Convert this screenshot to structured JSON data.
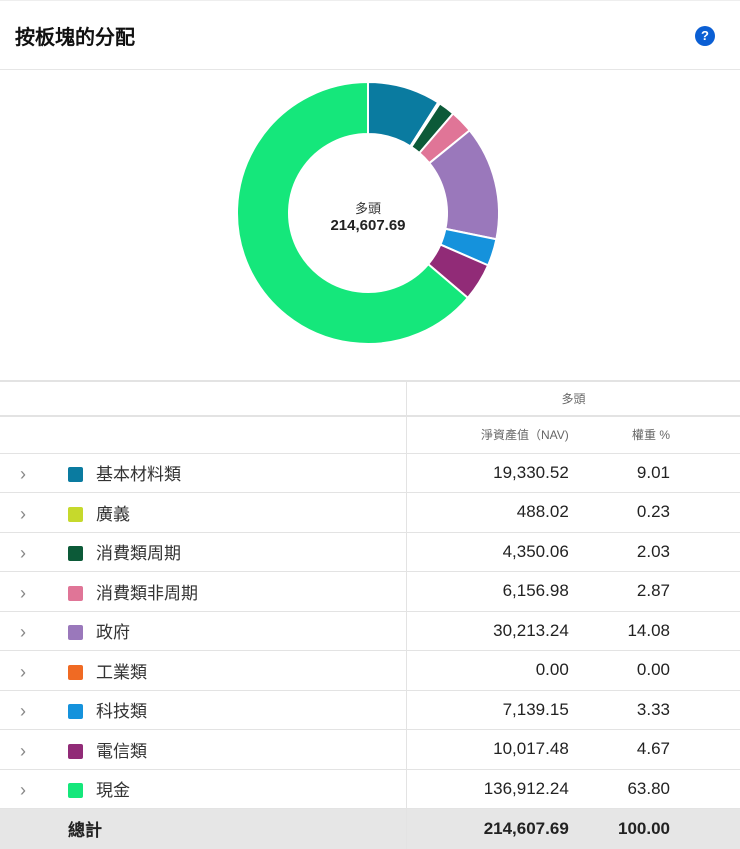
{
  "header": {
    "title": "按板塊的分配",
    "help_icon": "?"
  },
  "chart_data": {
    "type": "pie",
    "variant": "donut",
    "center_label": "多頭",
    "center_value": "214,607.69",
    "categories": [
      "基本材料類",
      "廣義",
      "消費類周期",
      "消費類非周期",
      "政府",
      "工業類",
      "科技類",
      "電信類",
      "現金"
    ],
    "values": [
      9.01,
      0.23,
      2.03,
      2.87,
      14.08,
      0.0,
      3.33,
      4.67,
      63.8
    ],
    "colors": [
      "#0a7ba0",
      "#c6d92c",
      "#0c5a38",
      "#e07597",
      "#9a78bb",
      "#f06a23",
      "#1592dc",
      "#912b77",
      "#15e77b"
    ]
  },
  "table": {
    "group_header": "多頭",
    "col_nav": "淨資產值（NAV)",
    "col_weight": "權重 %",
    "rows": [
      {
        "label": "基本材料類",
        "nav": "19,330.52",
        "weight": "9.01",
        "color": "#0a7ba0"
      },
      {
        "label": "廣義",
        "nav": "488.02",
        "weight": "0.23",
        "color": "#c6d92c"
      },
      {
        "label": "消費類周期",
        "nav": "4,350.06",
        "weight": "2.03",
        "color": "#0c5a38"
      },
      {
        "label": "消費類非周期",
        "nav": "6,156.98",
        "weight": "2.87",
        "color": "#e07597"
      },
      {
        "label": "政府",
        "nav": "30,213.24",
        "weight": "14.08",
        "color": "#9a78bb"
      },
      {
        "label": "工業類",
        "nav": "0.00",
        "weight": "0.00",
        "color": "#f06a23"
      },
      {
        "label": "科技類",
        "nav": "7,139.15",
        "weight": "3.33",
        "color": "#1592dc"
      },
      {
        "label": "電信類",
        "nav": "10,017.48",
        "weight": "4.67",
        "color": "#912b77"
      },
      {
        "label": "現金",
        "nav": "136,912.24",
        "weight": "63.80",
        "color": "#15e77b"
      }
    ],
    "total": {
      "label": "總計",
      "nav": "214,607.69",
      "weight": "100.00"
    }
  }
}
